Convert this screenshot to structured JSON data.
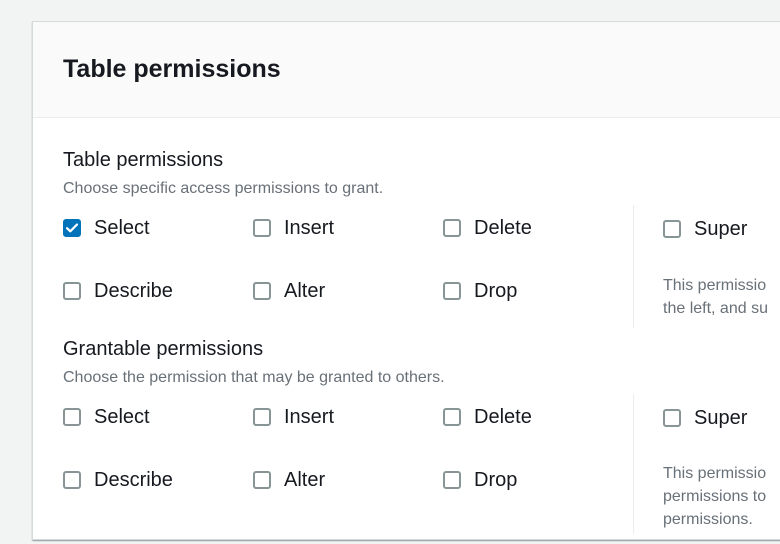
{
  "panel": {
    "title": "Table permissions"
  },
  "table_permissions": {
    "label": "Table permissions",
    "description": "Choose specific access permissions to grant.",
    "options": [
      {
        "label": "Select",
        "checked": true
      },
      {
        "label": "Insert",
        "checked": false
      },
      {
        "label": "Delete",
        "checked": false
      },
      {
        "label": "Describe",
        "checked": false
      },
      {
        "label": "Alter",
        "checked": false
      },
      {
        "label": "Drop",
        "checked": false
      }
    ],
    "super": {
      "label": "Super",
      "checked": false
    },
    "super_note_lines": [
      "This permissio",
      "the left, and su"
    ]
  },
  "grantable_permissions": {
    "label": "Grantable permissions",
    "description": "Choose the permission that may be granted to others.",
    "options": [
      {
        "label": "Select",
        "checked": false
      },
      {
        "label": "Insert",
        "checked": false
      },
      {
        "label": "Delete",
        "checked": false
      },
      {
        "label": "Describe",
        "checked": false
      },
      {
        "label": "Alter",
        "checked": false
      },
      {
        "label": "Drop",
        "checked": false
      }
    ],
    "super": {
      "label": "Super",
      "checked": false
    },
    "super_note_lines": [
      "This permissio",
      "permissions to",
      "permissions."
    ]
  },
  "colors": {
    "checkbox_checked": "#0073bb",
    "checkbox_border": "#879596",
    "muted_text": "#687078"
  }
}
